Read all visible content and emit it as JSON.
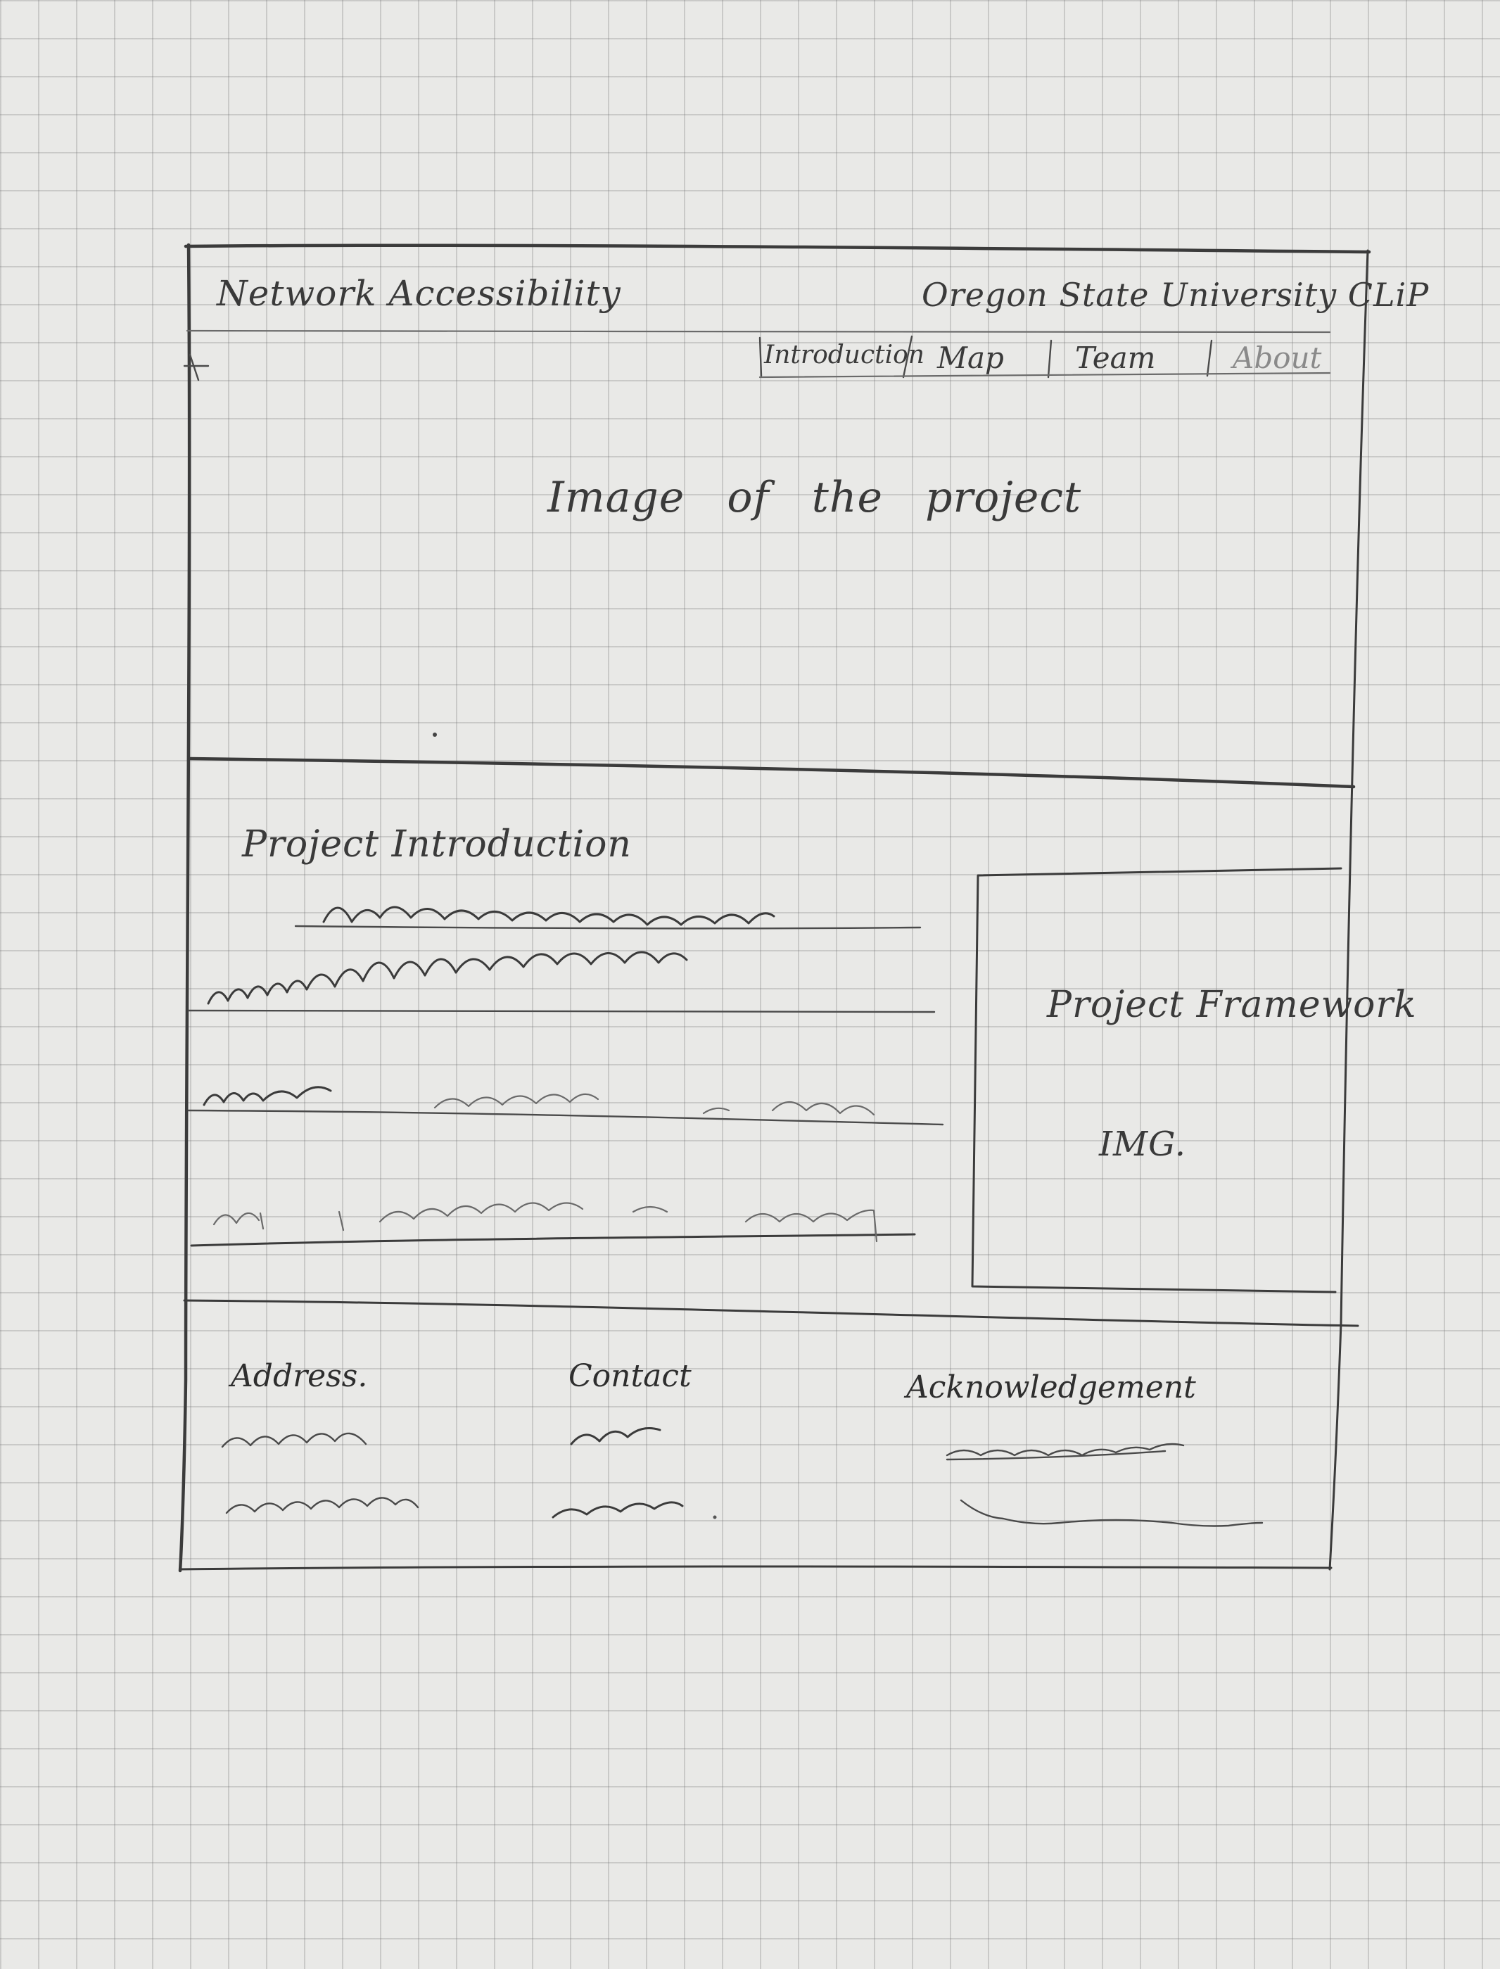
{
  "header": {
    "site_title": "Network Accessibility",
    "organization": "Oregon State University CLiP"
  },
  "nav": {
    "items": [
      {
        "label": "Introduction"
      },
      {
        "label": "Map"
      },
      {
        "label": "Team"
      },
      {
        "label": "About"
      }
    ]
  },
  "hero": {
    "placeholder": "Image of the project"
  },
  "intro": {
    "heading": "Project Introduction",
    "framework_label": "Project Framework",
    "framework_img": "IMG."
  },
  "footer": {
    "address_heading": "Address.",
    "contact_heading": "Contact",
    "acknowledgement_heading": "Acknowledgement"
  }
}
